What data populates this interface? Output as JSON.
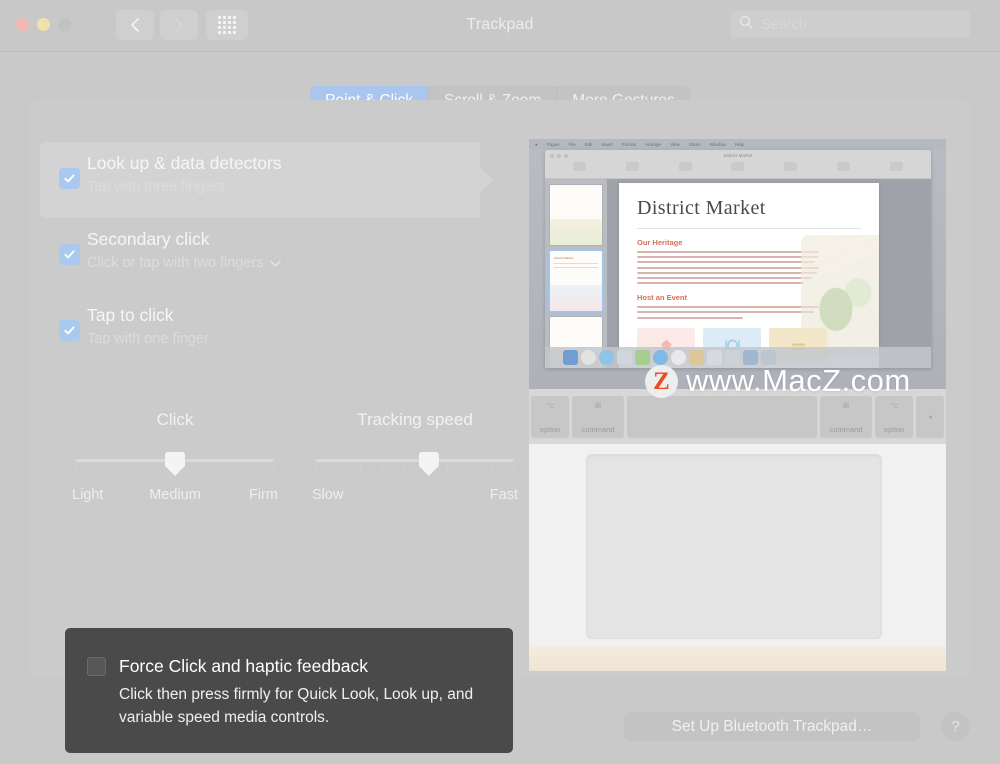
{
  "window": {
    "title": "Trackpad",
    "traffic_lights": [
      "close",
      "minimize",
      "zoom"
    ],
    "nav": {
      "back": "back-chevron",
      "forward": "forward-chevron",
      "show_all": "grid-icon"
    },
    "search": {
      "placeholder": "Search",
      "icon": "search-icon",
      "value": ""
    }
  },
  "tabs": [
    {
      "label": "Point & Click",
      "active": true
    },
    {
      "label": "Scroll & Zoom",
      "active": false
    },
    {
      "label": "More Gestures",
      "active": false
    }
  ],
  "options": [
    {
      "title": "Look up & data detectors",
      "subtitle": "Tap with three fingers",
      "checked": true,
      "highlighted": true,
      "has_dropdown": false
    },
    {
      "title": "Secondary click",
      "subtitle": "Click or tap with two fingers",
      "checked": true,
      "highlighted": false,
      "has_dropdown": true
    },
    {
      "title": "Tap to click",
      "subtitle": "Tap with one finger",
      "checked": true,
      "highlighted": false,
      "has_dropdown": false
    }
  ],
  "sliders": [
    {
      "label": "Click",
      "ticks": 3,
      "value_percent": 50,
      "value_label": "Medium",
      "scale_labels": [
        "Light",
        "Medium",
        "Firm"
      ]
    },
    {
      "label": "Tracking speed",
      "ticks": 10,
      "value_percent": 57,
      "value_label": "",
      "scale_labels": [
        "Slow",
        "Fast"
      ]
    }
  ],
  "tooltip": {
    "checkbox_checked": false,
    "title": "Force Click and haptic feedback",
    "description": "Click then press firmly for Quick Look, Look up, and variable speed media controls."
  },
  "preview": {
    "kind": "demo-video",
    "app_document_title": "District Market",
    "sections": [
      {
        "heading": "Our Heritage"
      },
      {
        "heading": "Host an Event"
      }
    ],
    "keyboard_keys": [
      {
        "glyph": "⌥",
        "label": "option"
      },
      {
        "glyph": "⌘",
        "label": "command"
      },
      {
        "glyph": "",
        "label": ""
      },
      {
        "glyph": "⌘",
        "label": "command"
      },
      {
        "glyph": "⌥",
        "label": "option"
      },
      {
        "glyph": "◂",
        "label": ""
      }
    ],
    "watermark": {
      "badge": "Z",
      "text": "www.MacZ.com",
      "badge_color": "#f04a23"
    }
  },
  "footer": {
    "setup_button": "Set Up Bluetooth Trackpad…",
    "help_button": "?"
  },
  "colors": {
    "window_bg": "#c9c9c9",
    "panel_bg": "#cbcbcb",
    "accent_blue": "#a8c6ee",
    "checkbox_blue": "#a9c9ef",
    "dark_panel": "#4a4a4a",
    "text_primary": "#f6f6f6",
    "text_secondary": "#dcdcdc"
  }
}
